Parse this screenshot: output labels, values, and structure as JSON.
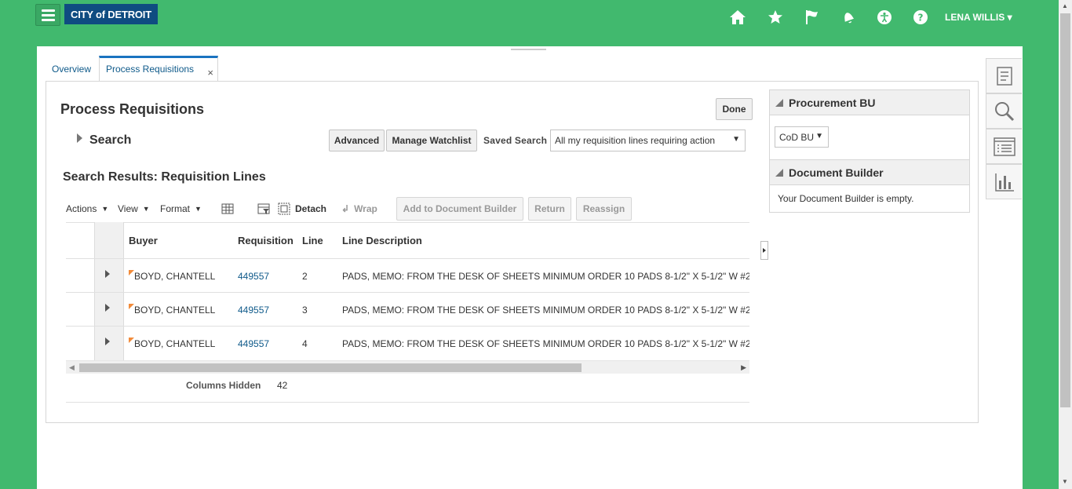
{
  "header": {
    "logo_text": "CITY of DETROIT",
    "user_name": "LENA WILLIS",
    "user_caret": "▾",
    "icons": [
      "home-icon",
      "star-icon",
      "flag-icon",
      "bell-icon",
      "accessibility-icon",
      "help-icon"
    ]
  },
  "tabs": [
    {
      "label": "Overview"
    },
    {
      "label": "Process Requisitions",
      "close": "×"
    }
  ],
  "page": {
    "title": "Process Requisitions",
    "done_label": "Done",
    "search_label": "Search",
    "advanced_label": "Advanced",
    "manage_watchlist_label": "Manage Watchlist",
    "saved_search_label": "Saved Search",
    "saved_search_value": "All my requisition lines requiring action",
    "results_title": "Search Results: Requisition Lines"
  },
  "toolbar": {
    "actions": "Actions",
    "view": "View",
    "format": "Format",
    "detach": "Detach",
    "wrap": "Wrap",
    "add_to_doc_builder": "Add to Document Builder",
    "return": "Return",
    "reassign": "Reassign"
  },
  "table": {
    "columns": [
      "Buyer",
      "Requisition",
      "Line",
      "Line Description"
    ],
    "rows": [
      {
        "buyer": "BOYD, CHANTELL",
        "requisition": "449557",
        "line": "2",
        "description": "PADS, MEMO: FROM THE DESK OF SHEETS MINIMUM ORDER 10 PADS 8-1/2\" X 5-1/2\" W #2"
      },
      {
        "buyer": "BOYD, CHANTELL",
        "requisition": "449557",
        "line": "3",
        "description": "PADS, MEMO: FROM THE DESK OF SHEETS MINIMUM ORDER 10 PADS 8-1/2\" X 5-1/2\" W #2"
      },
      {
        "buyer": "BOYD, CHANTELL",
        "requisition": "449557",
        "line": "4",
        "description": "PADS, MEMO: FROM THE DESK OF SHEETS MINIMUM ORDER 10 PADS 8-1/2\" X 5-1/2\" W #2"
      }
    ],
    "columns_hidden_label": "Columns Hidden",
    "columns_hidden_value": "42"
  },
  "right_panel": {
    "procurement_bu_title": "Procurement BU",
    "procurement_bu_value": "CoD BU",
    "document_builder_title": "Document Builder",
    "document_builder_empty": "Your Document Builder is empty."
  },
  "side_tabs": [
    "tasks-icon",
    "search-icon",
    "list-icon",
    "reports-icon"
  ],
  "colors": {
    "header_bg": "#41b96e",
    "logo_bg": "#0f4c81",
    "link": "#0f5a8a"
  }
}
